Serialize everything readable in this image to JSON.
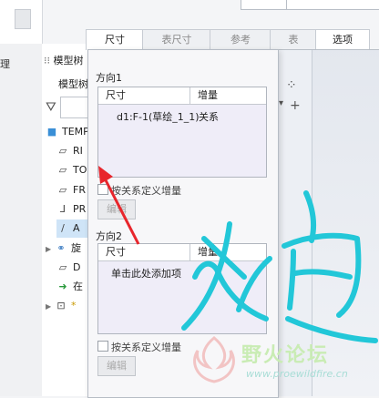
{
  "tabs": [
    {
      "label": "尺寸",
      "active": true
    },
    {
      "label": "表尺寸",
      "active": false
    },
    {
      "label": "参考",
      "active": false
    },
    {
      "label": "表",
      "active": false
    },
    {
      "label": "选项",
      "active": false
    }
  ],
  "tree": {
    "header": "模型树",
    "header_sub": "模型树",
    "left_char": "理",
    "root": "TEMP",
    "items": [
      "RI",
      "TO",
      "FR",
      "PR",
      "A",
      "旋",
      "D",
      "在",
      "*"
    ]
  },
  "panel": {
    "dir1": {
      "label": "方向1",
      "col_dim": "尺寸",
      "col_inc": "增量",
      "row_dim": "d1:F-1(草绘_1_1)",
      "row_inc": "关系",
      "checkbox": "按关系定义增量",
      "edit": "编辑"
    },
    "dir2": {
      "label": "方向2",
      "col_dim": "尺寸",
      "col_inc": "增量",
      "row_dim": "单击此处添加项",
      "checkbox": "按关系定义增量",
      "edit": "编辑"
    }
  },
  "watermark": {
    "text": "野火论坛",
    "url": "www.proewildfire.cn"
  },
  "colors": {
    "annotation": "#22c7d8",
    "arrow": "#e8262c",
    "table_bg": "#efedf8"
  }
}
